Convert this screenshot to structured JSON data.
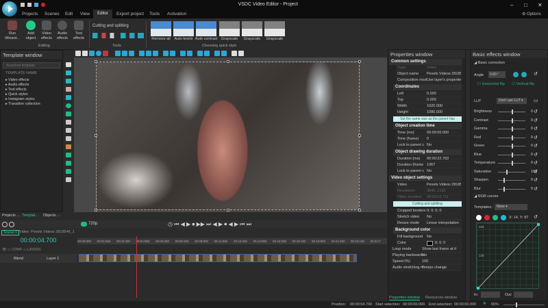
{
  "app": {
    "title": "VSDC Video Editor - Project",
    "options_label": "Options"
  },
  "menu": [
    "Projects",
    "Scenes",
    "Edit",
    "View",
    "Editor",
    "Export project",
    "Tools",
    "Activation"
  ],
  "ribbon": {
    "editing": {
      "items": [
        "Run Wizard...",
        "Add object",
        "Video effects",
        "Audio effects",
        "Text effects"
      ],
      "group": "Editing"
    },
    "tools": {
      "cutting": "Cutting and splitting",
      "group": "Tools"
    },
    "quick_style": {
      "items": [
        "Remove all",
        "Auto levels",
        "Auto contrast",
        "Grayscale",
        "Grayscale",
        "Grayscale"
      ],
      "group": "Choosing quick style"
    }
  },
  "template_window": {
    "title": "Template window",
    "search_placeholder": "Searched template",
    "header": "TEMPLATE NAME",
    "items": [
      "Video effects",
      "Audio effects",
      "Text effects",
      "Quick styles",
      "Instagram styles",
      "Transition collection"
    ]
  },
  "bottom_tabs": [
    "Projects ...",
    "Templat...",
    "Objects ..."
  ],
  "timeline": {
    "resolution": "720p",
    "scene_tab": "Scene 0",
    "clip_tab": "Video: Pexels Videos 2818546_1",
    "time": "00:00:04.700",
    "comp_label": "COMP.",
    "layers_label": "LAYERS",
    "blend": "Blend",
    "layer": "Layer 1",
    "ruler": [
      "00:00:000",
      "00:01:650",
      "00:03:300",
      "00:04:950",
      "00:06:600",
      "00:08:250",
      "00:09:900",
      "00:11:550",
      "00:13:200",
      "00:14:850",
      "00:16:500",
      "00:18:150",
      "00:19:800",
      "00:21:450",
      "00:23:100",
      "00:24:7"
    ]
  },
  "properties": {
    "title": "Properties window",
    "common": "Common settings",
    "type_label": "Type",
    "type_value": "Video",
    "object_name_label": "Object name",
    "object_name": "Pexels Videos 2818546",
    "composition_label": "Composition mod",
    "composition": "Use layer's properties",
    "coordinates": "Coordinates",
    "left_label": "Left",
    "left": "0.000",
    "top_label": "Top",
    "top": "0.000",
    "width_label": "Width",
    "width": "1920.000",
    "height_label": "Height",
    "height": "1080.000",
    "same_size": "Set the same size as the parent has",
    "creation": "Object creation time",
    "time_ms_label": "Time (ms)",
    "time_ms": "00:00:00.000",
    "time_frame_label": "Time (frame)",
    "time_frame": "0",
    "lock_label": "Lock to parent c",
    "lock": "No",
    "drawing": "Object drawing duration",
    "dur_ms_label": "Duration (ms)",
    "dur_ms": "00:00:22.783",
    "dur_frame_label": "Duration (frame",
    "dur_frame": "1367",
    "lock2_label": "Lock to parent c",
    "lock2": "No",
    "video_settings": "Video object settings",
    "video_label": "Video",
    "video": "Pexels Videos 2818546",
    "resolution_label": "Resolution",
    "resolution": "3840; 2160",
    "vduration_label": "Video duration",
    "vduration": "00:00:22.711",
    "cutting": "Cutting and splitting",
    "cropped_label": "Cropped borders",
    "cropped": "0; 0; 0; 0",
    "stretch_label": "Stretch video",
    "stretch": "No",
    "resize_label": "Resize mode",
    "resize": "Linear interpolation",
    "bg": "Background color",
    "fill_label": "Fill background",
    "fill": "No",
    "color_label": "Color",
    "color": "0; 0; 0",
    "loop_label": "Loop mode",
    "loop": "Show last frame at the end",
    "back_label": "Playing backwards",
    "back": "No",
    "speed_label": "Speed (%)",
    "speed": "100",
    "stretch_audio_label": "Audio stretching m",
    "stretch_audio": "Tempo change",
    "tabs": [
      "Properties window",
      "Resources window"
    ]
  },
  "effects": {
    "title": "Basic effects window",
    "basic": "Basic correction",
    "angle_label": "Angle",
    "angle": "0.00 °",
    "hflip": "Horizontal flip",
    "vflip": "Vertical flip",
    "lut_label": "LUT",
    "lut": "Don't use LUT",
    "sliders": [
      {
        "label": "Brightness",
        "value": "0",
        "level": 0.5
      },
      {
        "label": "Contrast",
        "value": "0",
        "level": 0.5
      },
      {
        "label": "Gamma",
        "value": "0",
        "level": 0.5
      },
      {
        "label": "Red",
        "value": "0",
        "level": 0.5
      },
      {
        "label": "Green",
        "value": "0",
        "level": 0.5
      },
      {
        "label": "Blue",
        "value": "0",
        "level": 0.5
      },
      {
        "label": "Temperature",
        "value": "0",
        "level": 0.5
      },
      {
        "label": "Saturation",
        "value": "100",
        "level": 0.3
      },
      {
        "label": "Sharpen",
        "value": "0",
        "level": 0.2
      },
      {
        "label": "Blur",
        "value": "0",
        "level": 0.2
      }
    ],
    "rgb": "RGB curves",
    "templates_label": "Templates:",
    "templates": "None",
    "coords": "X: 14, Y: 87",
    "y_max": "255",
    "y_mid": "128",
    "in_label": "In:",
    "out_label": "Out:",
    "channel_colors": [
      "#ffffff",
      "#e0203a",
      "#20c080",
      "#20b8e0"
    ]
  },
  "status": {
    "position_label": "Position:",
    "position": "00:00:04.700",
    "start_label": "Start selection:",
    "start": "00:00:00.000",
    "end_label": "End selection:",
    "end": "00:00:00.000",
    "zoom": "65%"
  }
}
